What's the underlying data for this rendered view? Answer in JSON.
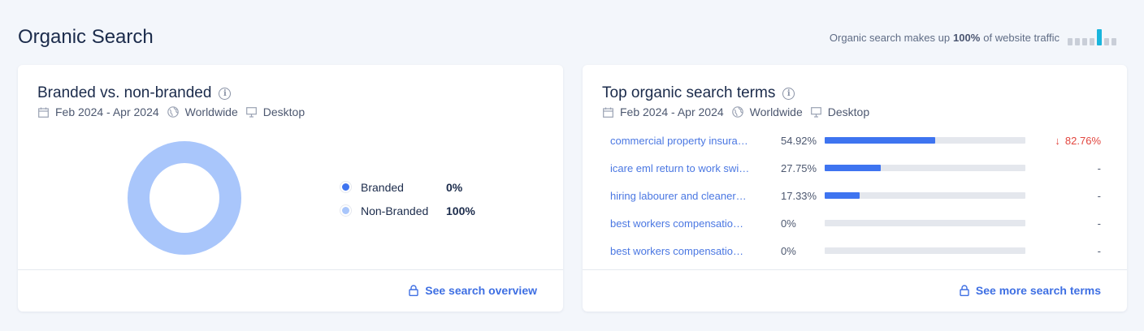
{
  "page": {
    "title": "Organic Search",
    "traffic_prefix": "Organic search makes up",
    "traffic_value": "100%",
    "traffic_suffix": "of website traffic",
    "traffic_bars": [
      0.45,
      0.45,
      0.45,
      0.45,
      1.0,
      0.45,
      0.45
    ],
    "traffic_active_index": 4
  },
  "branded_card": {
    "title": "Branded vs. non-branded",
    "date_range": "Feb 2024 - Apr 2024",
    "region": "Worldwide",
    "device": "Desktop",
    "legend": [
      {
        "label": "Branded",
        "value": "0%",
        "color": "#3e74f0"
      },
      {
        "label": "Non-Branded",
        "value": "100%",
        "color": "#a9c6fb"
      }
    ],
    "footer_link": "See search overview"
  },
  "chart_data": {
    "type": "pie",
    "categories": [
      "Branded",
      "Non-Branded"
    ],
    "values": [
      0,
      100
    ],
    "colors": [
      "#3e74f0",
      "#a9c6fb"
    ],
    "title": "Branded vs. non-branded"
  },
  "terms_card": {
    "title": "Top organic search terms",
    "date_range": "Feb 2024 - Apr 2024",
    "region": "Worldwide",
    "device": "Desktop",
    "rows": [
      {
        "term": "commercial property insura…",
        "share": "54.92%",
        "share_value": 54.92,
        "change": "82.76%",
        "change_dir": "down"
      },
      {
        "term": "icare eml return to work swi…",
        "share": "27.75%",
        "share_value": 27.75,
        "change": "-",
        "change_dir": "none"
      },
      {
        "term": "hiring labourer and cleaner…",
        "share": "17.33%",
        "share_value": 17.33,
        "change": "-",
        "change_dir": "none"
      },
      {
        "term": "best workers compensatio…",
        "share": "0%",
        "share_value": 0,
        "change": "-",
        "change_dir": "none"
      },
      {
        "term": "best workers compensatio…",
        "share": "0%",
        "share_value": 0,
        "change": "-",
        "change_dir": "none"
      }
    ],
    "footer_link": "See more search terms"
  },
  "colors": {
    "accent": "#3e74f0",
    "link": "#3e6fe3",
    "negative": "#e2463f",
    "traffic_active": "#19b5dd"
  }
}
